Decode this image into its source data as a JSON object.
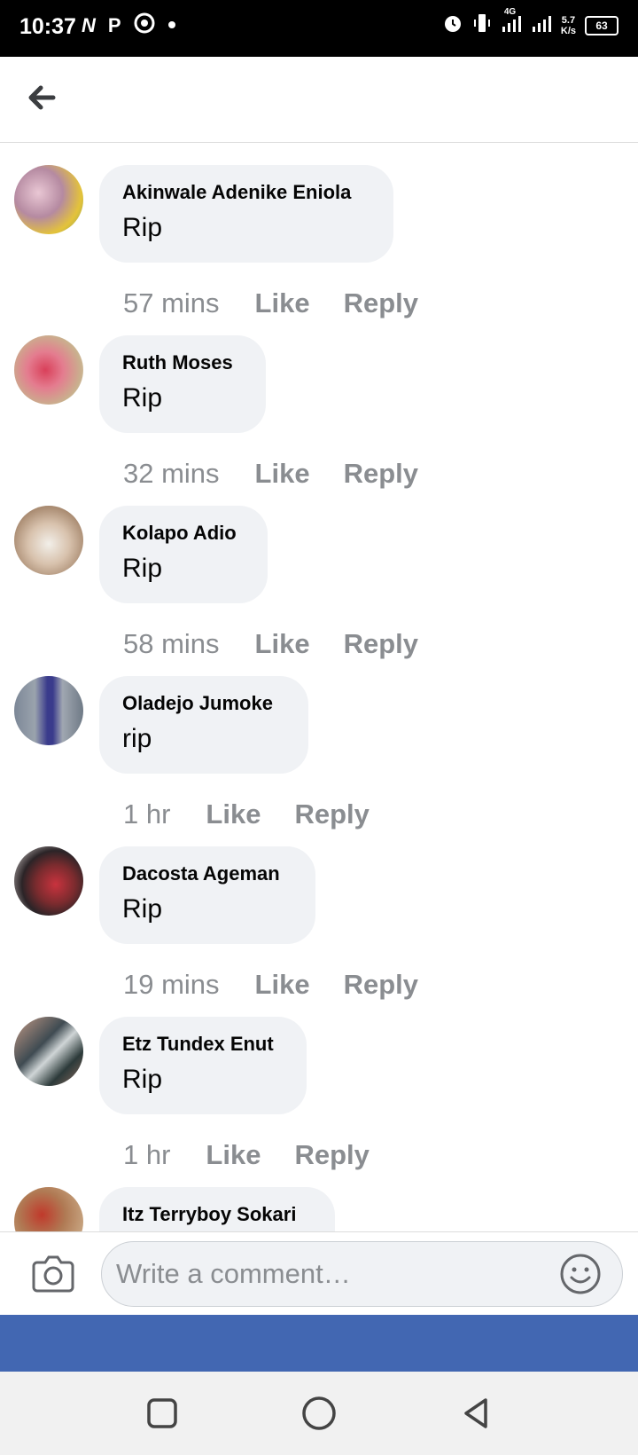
{
  "status_bar": {
    "time": "10:37",
    "left_icons": [
      "netflix-icon",
      "pinterest-icon",
      "chrome-icon",
      "dot-icon"
    ],
    "network": "4G",
    "speed_value": "5.7",
    "speed_unit": "K/s",
    "battery": "63"
  },
  "header": {
    "back_icon": "arrow-left-icon"
  },
  "comments": [
    {
      "author": "Akinwale Adenike Eniola",
      "text": "Rip",
      "time": "57 mins",
      "like": "Like",
      "reply": "Reply"
    },
    {
      "author": "Ruth Moses",
      "text": "Rip",
      "time": "32 mins",
      "like": "Like",
      "reply": "Reply"
    },
    {
      "author": "Kolapo Adio",
      "text": "Rip",
      "time": "58 mins",
      "like": "Like",
      "reply": "Reply"
    },
    {
      "author": "Oladejo Jumoke",
      "text": "rip",
      "time": "1 hr",
      "like": "Like",
      "reply": "Reply"
    },
    {
      "author": "Dacosta Ageman",
      "text": "Rip",
      "time": "19 mins",
      "like": "Like",
      "reply": "Reply"
    },
    {
      "author": "Etz Tundex Enut",
      "text": "Rip",
      "time": "1 hr",
      "like": "Like",
      "reply": "Reply"
    },
    {
      "author": "Itz Terryboy Sokari"
    }
  ],
  "composer": {
    "placeholder": "Write a comment…",
    "camera_icon": "camera-icon",
    "emoji_icon": "smiley-icon"
  },
  "colors": {
    "brand_blue": "#4267b2",
    "bubble_bg": "#f0f2f5",
    "meta_text": "#8a8d91"
  },
  "nav_bar": [
    "recents-square-icon",
    "home-circle-icon",
    "back-triangle-icon"
  ]
}
